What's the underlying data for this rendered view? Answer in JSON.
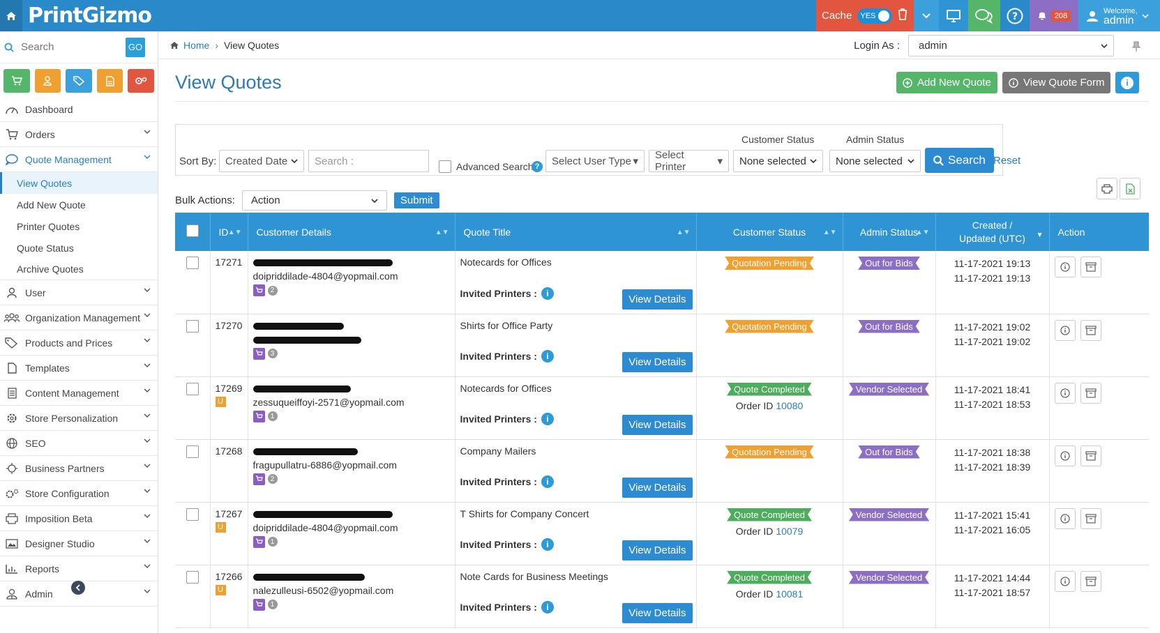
{
  "app": {
    "logo": "PrintGizmo"
  },
  "topbar": {
    "cache_label": "Cache",
    "cache_toggle": "YES",
    "notification_count": "208",
    "welcome_label": "Welcome,",
    "user_name": "admin",
    "colors": {
      "bar": "#2a89c8",
      "cache": "#e2563f",
      "chevron": "#3ca0dc",
      "monitor": "#2f94d4",
      "chat": "#55b66a",
      "help": "#2a89c8",
      "bell": "#8d6ec5",
      "user": "#3ca0dc"
    }
  },
  "sidebar": {
    "search_placeholder": "Search",
    "go_label": "GO",
    "quick_buttons": [
      {
        "icon": "cart-icon",
        "color": "#55b66a"
      },
      {
        "icon": "user-icon",
        "color": "#f0a030"
      },
      {
        "icon": "tag-icon",
        "color": "#3ca0dc"
      },
      {
        "icon": "document-icon",
        "color": "#f0a030"
      },
      {
        "icon": "gears-icon",
        "color": "#e2563f"
      }
    ],
    "menu": [
      {
        "label": "Dashboard",
        "icon": "dashboard-icon"
      },
      {
        "label": "Orders",
        "icon": "cart-icon"
      },
      {
        "label": "Quote Management",
        "icon": "chat-icon"
      },
      {
        "label": "User",
        "icon": "user-icon"
      },
      {
        "label": "Organization Management",
        "icon": "users-icon"
      },
      {
        "label": "Products and Prices",
        "icon": "tags-icon"
      },
      {
        "label": "Templates",
        "icon": "file-icon"
      },
      {
        "label": "Content Management",
        "icon": "content-icon"
      },
      {
        "label": "Store Personalization",
        "icon": "gear-icon"
      },
      {
        "label": "SEO",
        "icon": "globe-icon"
      },
      {
        "label": "Business Partners",
        "icon": "partners-icon"
      },
      {
        "label": "Store Configuration",
        "icon": "gears-icon"
      },
      {
        "label": "Imposition Beta",
        "icon": "printer-icon"
      },
      {
        "label": "Designer Studio",
        "icon": "image-icon"
      },
      {
        "label": "Reports",
        "icon": "chart-icon"
      },
      {
        "label": "Admin",
        "icon": "admin-icon"
      }
    ],
    "quote_submenu": [
      "View Quotes",
      "Add New Quote",
      "Printer Quotes",
      "Quote Status",
      "Archive Quotes"
    ]
  },
  "breadcrumb": {
    "home": "Home",
    "current": "View Quotes"
  },
  "login_as": {
    "label": "Login As :",
    "value": "admin"
  },
  "page": {
    "title": "View Quotes",
    "add_btn": "Add New Quote",
    "view_form_btn": "View Quote Form"
  },
  "filters": {
    "sort_by_label": "Sort By:",
    "sort_by_value": "Created Date",
    "search_placeholder": "Search :",
    "advanced_search": "Advanced Search",
    "user_type": "Select User Type",
    "printer": "Select Printer",
    "customer_status_label": "Customer Status",
    "customer_status_value": "None selected",
    "admin_status_label": "Admin Status",
    "admin_status_value": "None selected",
    "search_btn": "Search",
    "reset": "Reset"
  },
  "bulk": {
    "label": "Bulk Actions:",
    "value": "Action",
    "submit": "Submit"
  },
  "table": {
    "headers": [
      "ID",
      "Customer Details",
      "Quote Title",
      "Customer Status",
      "Admin Status",
      "Created / Updated (UTC)",
      "Action"
    ],
    "invited_label": "Invited Printers :",
    "view_details": "View Details",
    "order_id_label": "Order ID",
    "rows": [
      {
        "id": "17271",
        "email": "doipriddilade-4804@yopmail.com",
        "u": false,
        "count": "2",
        "title": "Notecards for Offices",
        "cstatus": "Quotation Pending",
        "order": "",
        "astatus": "Out for Bids",
        "created": "11-17-2021 19:13",
        "updated": "11-17-2021 19:13"
      },
      {
        "id": "17270",
        "email": "",
        "u": false,
        "count": "3",
        "title": "Shirts for Office Party",
        "cstatus": "Quotation Pending",
        "order": "",
        "astatus": "Out for Bids",
        "created": "11-17-2021 19:02",
        "updated": "11-17-2021 19:02"
      },
      {
        "id": "17269",
        "email": "zessuqueiffoyi-2571@yopmail.com",
        "u": true,
        "count": "1",
        "title": "Notecards for Offices",
        "cstatus": "Quote Completed",
        "order": "10080",
        "astatus": "Vendor Selected",
        "created": "11-17-2021 18:41",
        "updated": "11-17-2021 18:53"
      },
      {
        "id": "17268",
        "email": "fragupullatru-6886@yopmail.com",
        "u": false,
        "count": "2",
        "title": "Company Mailers",
        "cstatus": "Quotation Pending",
        "order": "",
        "astatus": "Out for Bids",
        "created": "11-17-2021 18:38",
        "updated": "11-17-2021 18:39"
      },
      {
        "id": "17267",
        "email": "doipriddilade-4804@yopmail.com",
        "u": true,
        "count": "1",
        "title": "T Shirts for Company Concert",
        "cstatus": "Quote Completed",
        "order": "10079",
        "astatus": "Vendor Selected",
        "created": "11-17-2021 15:41",
        "updated": "11-17-2021 16:05"
      },
      {
        "id": "17266",
        "email": "nalezulleusi-6502@yopmail.com",
        "u": true,
        "count": "1",
        "title": "Note Cards for Business Meetings",
        "cstatus": "Quote Completed",
        "order": "10081",
        "astatus": "Vendor Selected",
        "created": "11-17-2021 14:44",
        "updated": "11-17-2021 18:57"
      }
    ]
  },
  "colors": {
    "pending": "#f0a030",
    "completed": "#4cae5c",
    "admin_status": "#8d6ec5",
    "primary": "#2d8bd1",
    "header": "#2f94d4"
  }
}
